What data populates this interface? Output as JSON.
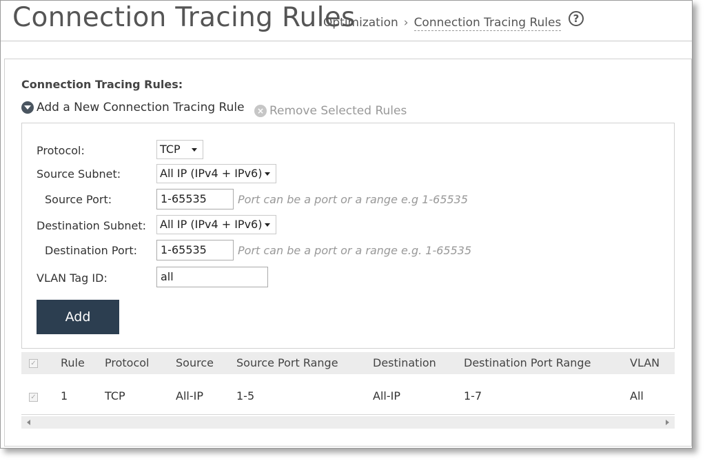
{
  "header": {
    "title": "Connection Tracing Rules",
    "breadcrumb": [
      "Optimization",
      "Connection Tracing Rules"
    ],
    "breadcrumb_separator": "›",
    "help_icon": "?"
  },
  "section": {
    "label": "Connection Tracing Rules:",
    "add_action": "Add a New Connection Tracing Rule",
    "remove_action": "Remove Selected Rules"
  },
  "form": {
    "protocol_label": "Protocol:",
    "protocol_value": "TCP",
    "source_subnet_label": "Source Subnet:",
    "source_subnet_value": "All IP (IPv4 + IPv6)",
    "source_port_label": "Source Port:",
    "source_port_value": "1-65535",
    "source_port_hint": "Port can be a port or a range e.g 1-65535",
    "dest_subnet_label": "Destination Subnet:",
    "dest_subnet_value": "All IP (IPv4 + IPv6)",
    "dest_port_label": "Destination Port:",
    "dest_port_value": "1-65535",
    "dest_port_hint": "Port can be a port or a range e.g. 1-65535",
    "vlan_label": "VLAN Tag ID:",
    "vlan_value": "all",
    "add_button": "Add"
  },
  "table": {
    "columns": [
      "Rule",
      "Protocol",
      "Source",
      "Source Port Range",
      "Destination",
      "Destination Port Range",
      "VLAN"
    ],
    "rows": [
      [
        "1",
        "TCP",
        "All-IP",
        "1-5",
        "All-IP",
        "1-7",
        "All"
      ]
    ]
  },
  "colors": {
    "button_bg": "#2c3e50",
    "header_row_bg": "#ececec",
    "hint_text": "#999999"
  }
}
